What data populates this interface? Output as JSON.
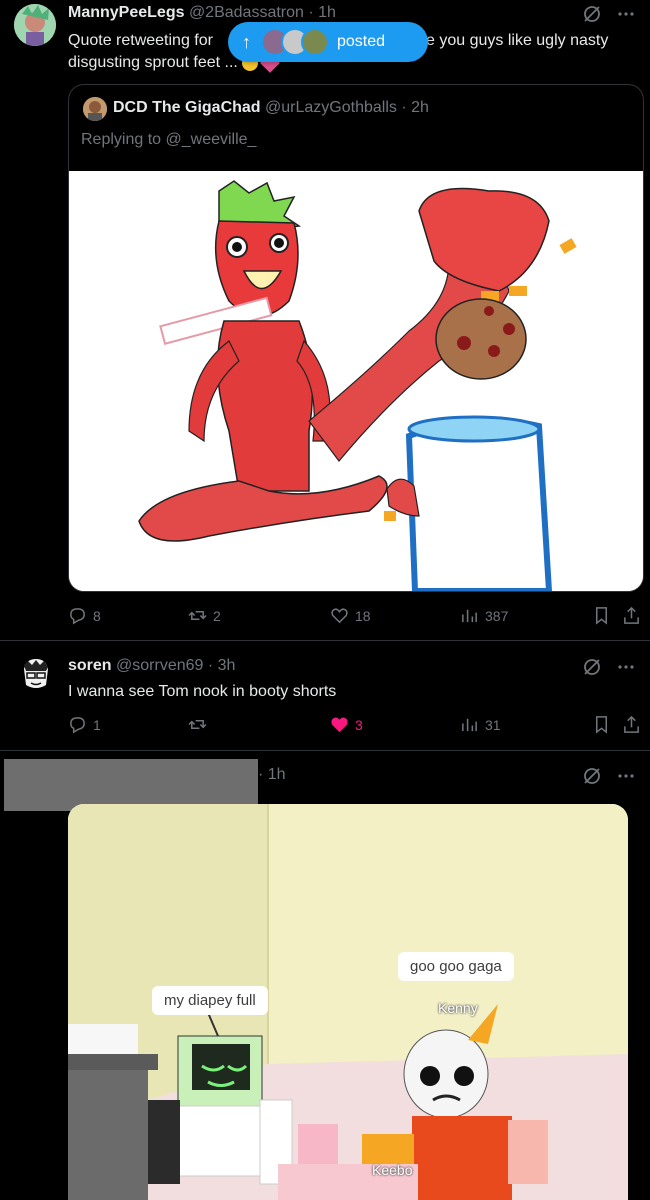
{
  "post1": {
    "display_name": "MannyPeeLegs",
    "handle_time": "@2Badassatron · 1h",
    "text_line1_left": "Quote retweeting for",
    "text_line1_right": "e you guys like ugly nasty",
    "text_line2": "disgusting sprout feet ..."
  },
  "new_posts_pill": {
    "label": "posted",
    "arrow": "↑"
  },
  "quote": {
    "display_name": "DCD The GigaChad",
    "handle_time": "@urLazyGothballs · 2h",
    "replying_to": "Replying to @_weeville_",
    "actions": {
      "replies": "8",
      "reposts": "2",
      "likes": "18",
      "views": "387"
    }
  },
  "post2": {
    "display_name": "soren",
    "handle_time": "@sorrven69 · 3h",
    "text": "I wanna see Tom nook in booty shorts",
    "actions": {
      "replies": "1",
      "reposts": "",
      "likes": "3",
      "views": "31"
    }
  },
  "post3": {
    "time": "· 1h",
    "bubble_left": "my diapey full",
    "bubble_right": "goo goo gaga",
    "nametag_right": "Kenny",
    "nametag_bottom": "Keebo"
  },
  "colors": {
    "accent": "#1d9bf0",
    "like_pink": "#f91880",
    "muted": "#71767b",
    "divider": "#2f3336"
  },
  "icons": [
    "grok-icon",
    "more-icon",
    "reply-icon",
    "repost-icon",
    "like-icon",
    "views-icon",
    "bookmark-icon",
    "share-icon",
    "arrow-up-icon"
  ]
}
